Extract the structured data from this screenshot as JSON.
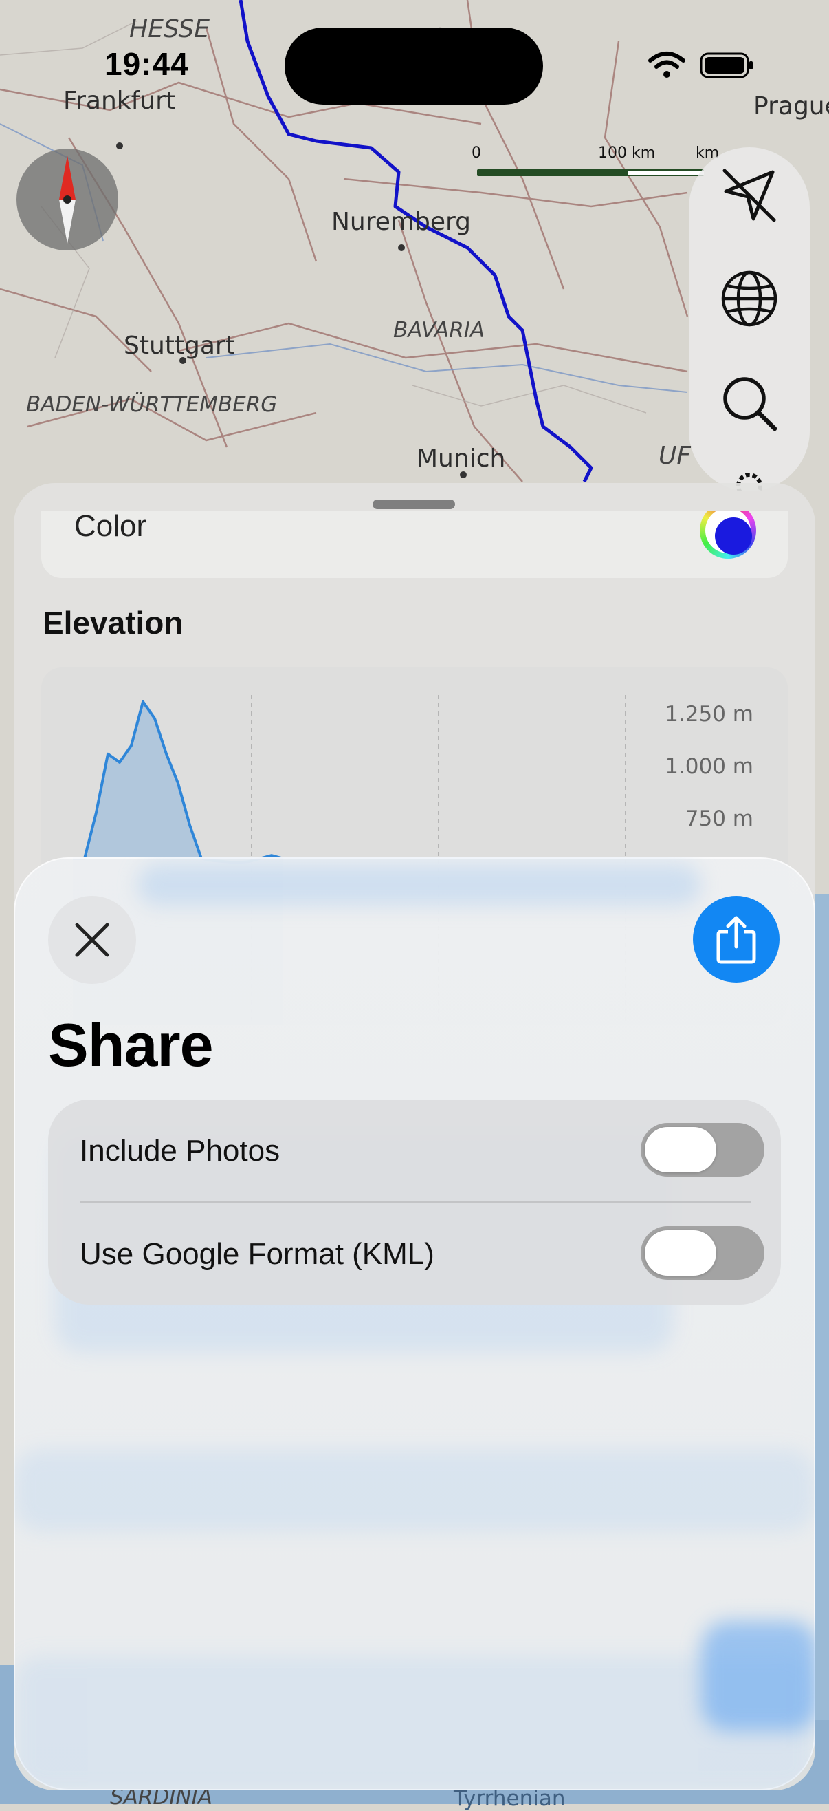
{
  "status_bar": {
    "time": "19:44"
  },
  "map": {
    "labels": {
      "hesse": "HESSE",
      "frankfurt": "Frankfurt",
      "prague": "Prague",
      "nuremberg": "Nuremberg",
      "bavaria": "BAVARIA",
      "stuttgart": "Stuttgart",
      "baden_wuerttemberg": "BADEN-WÜRTTEMBERG",
      "munich": "Munich",
      "upper_austria_partial": "UF",
      "sardinia": "SARDINIA",
      "tyrrhenian": "Tyrrhenian"
    },
    "scale": {
      "zero": "0",
      "distance": "100 km",
      "unit_partial": "km"
    },
    "route_color": "#1212c8"
  },
  "toolbar": {
    "icons": [
      "location-arrow-icon",
      "globe-icon",
      "search-icon",
      "gear-icon"
    ]
  },
  "detail_sheet": {
    "color_label": "Color",
    "color_value": "#1a1adf",
    "elevation_title": "Elevation",
    "elevation_chart": {
      "y_ticks": [
        "1.250 m",
        "1.000 m",
        "750 m"
      ]
    }
  },
  "chart_data": {
    "type": "area",
    "title": "",
    "xlabel": "",
    "ylabel": "",
    "ylim": [
      500,
      1350
    ],
    "y_ticks": [
      1250,
      1000,
      750
    ],
    "series": [
      {
        "x": [
          0,
          1,
          2,
          3,
          4,
          5,
          6,
          7,
          8,
          9,
          10,
          11,
          12,
          13,
          14,
          15,
          16,
          17,
          18
        ],
        "values": [
          560,
          560,
          780,
          1060,
          1020,
          1100,
          1310,
          1230,
          1060,
          920,
          720,
          560,
          550,
          545,
          540,
          545,
          560,
          575,
          560
        ]
      }
    ]
  },
  "share": {
    "title": "Share",
    "options": [
      {
        "label": "Include Photos",
        "on": false
      },
      {
        "label": "Use Google Format (KML)",
        "on": false
      }
    ]
  },
  "colors": {
    "accent": "#1287f3",
    "toggle_off": "#a3a3a3"
  }
}
